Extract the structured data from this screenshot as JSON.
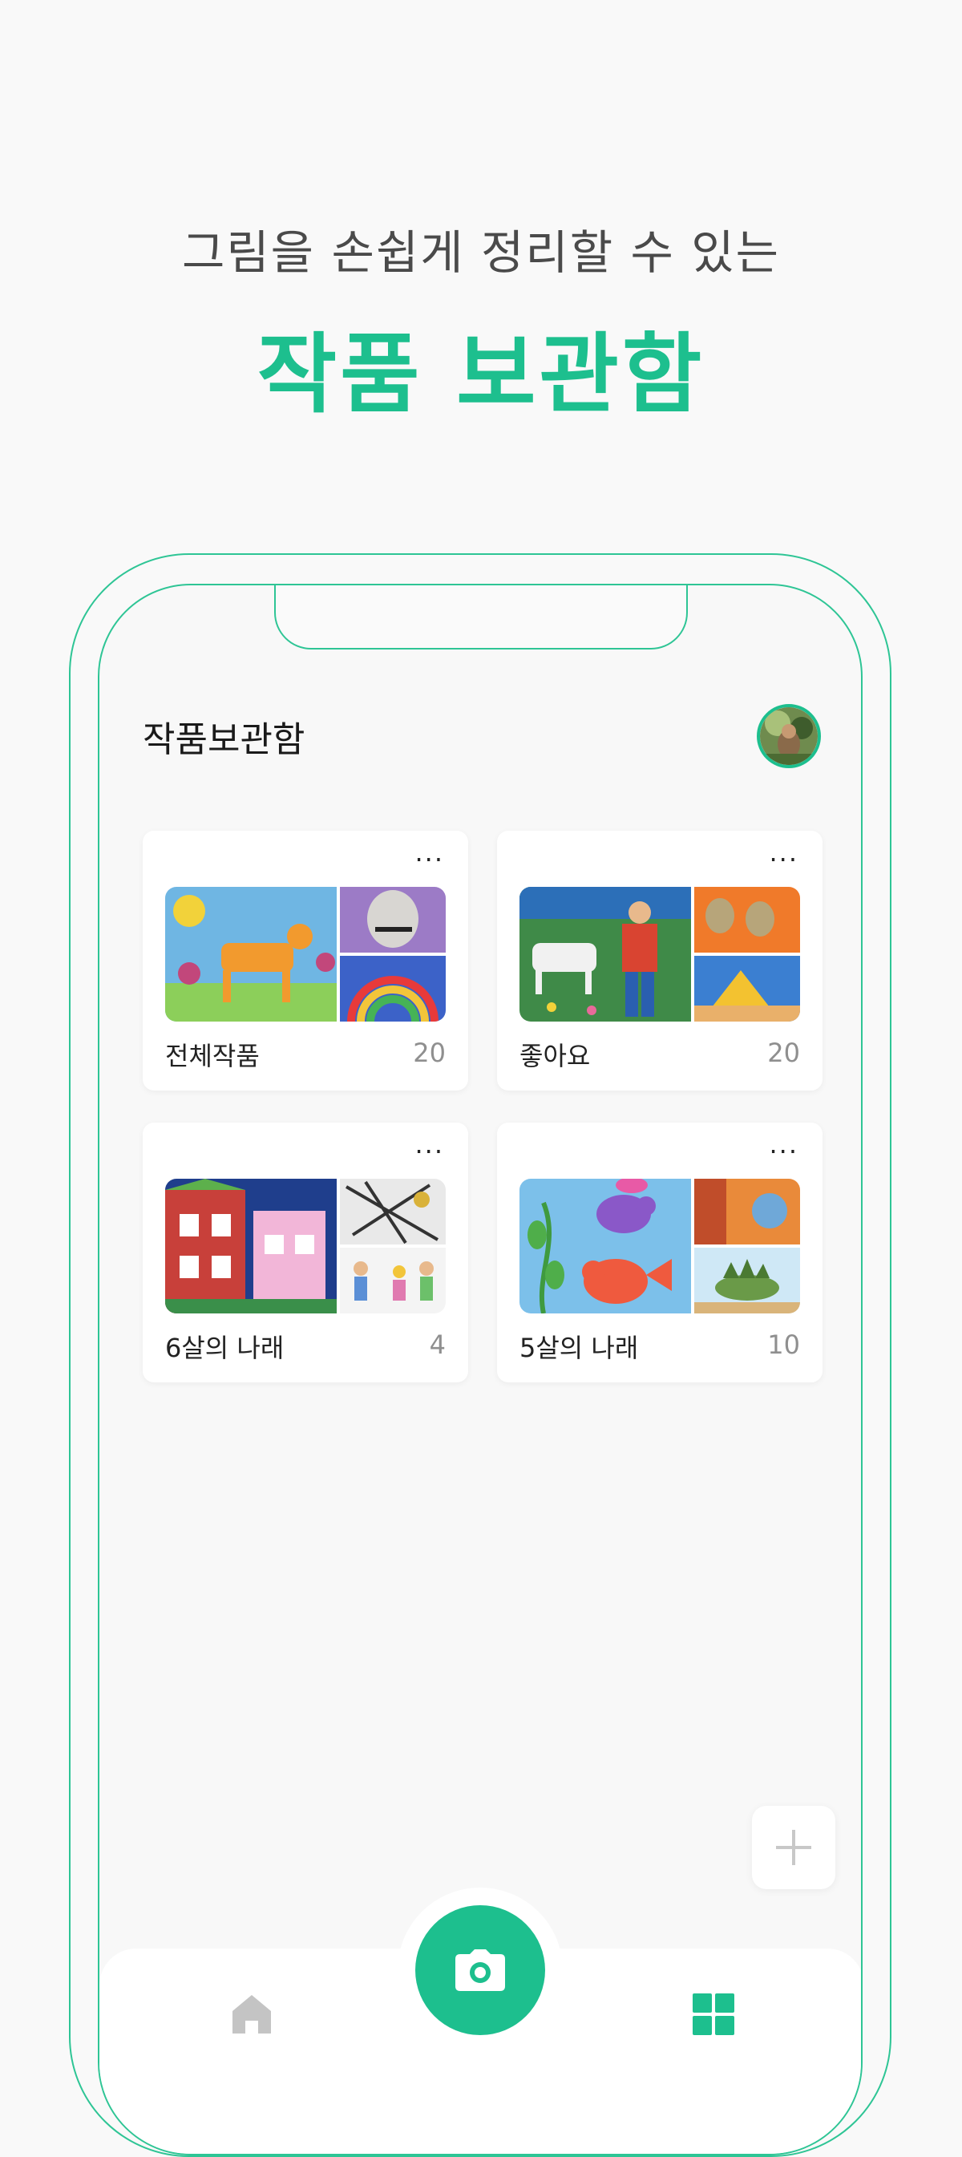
{
  "promo": {
    "subtitle": "그림을 손쉽게 정리할 수 있는",
    "title": "작품 보관함"
  },
  "screen": {
    "title": "작품보관함"
  },
  "albums": [
    {
      "name": "전체작품",
      "count": "20"
    },
    {
      "name": "좋아요",
      "count": "20"
    },
    {
      "name": "6살의 나래",
      "count": "4"
    },
    {
      "name": "5살의 나래",
      "count": "10"
    }
  ],
  "more_label": "···",
  "icons": {
    "add": "plus-icon",
    "camera": "camera-icon",
    "home": "home-icon",
    "grid": "grid-icon",
    "more": "more-dots-icon"
  },
  "colors": {
    "accent": "#1dbf8e",
    "title_text": "#1a1a1a",
    "count_text": "#8f8f8f",
    "inactive_tab": "#c4c4c4"
  }
}
